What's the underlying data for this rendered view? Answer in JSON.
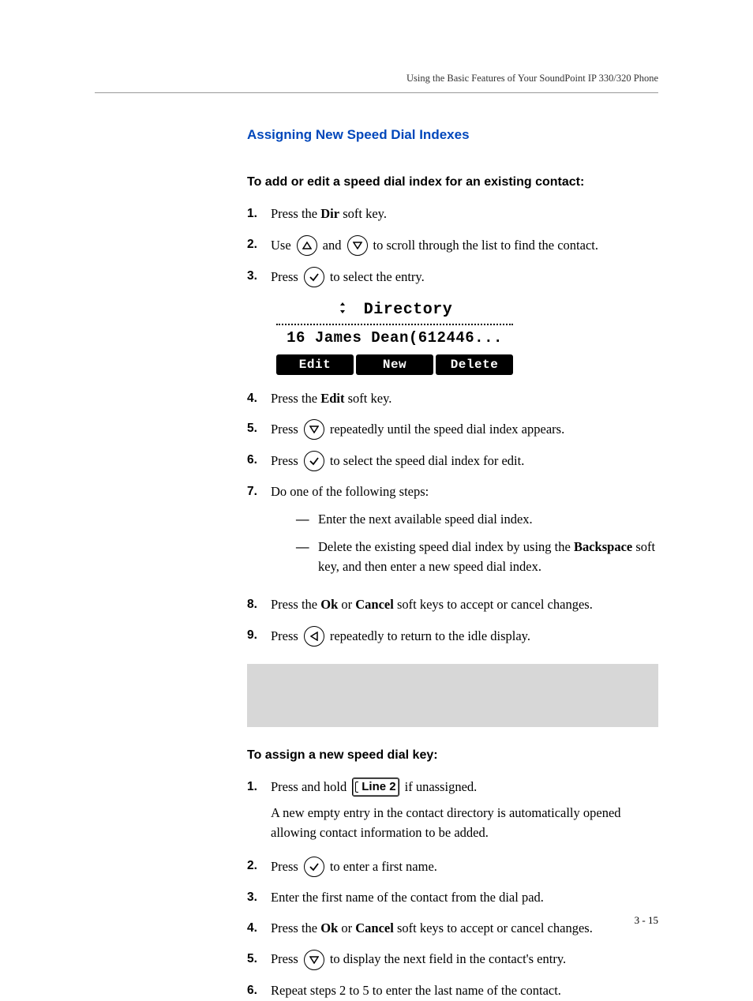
{
  "header": "Using the Basic Features of Your SoundPoint IP 330/320 Phone",
  "section_title": "Assigning New Speed Dial Indexes",
  "sub1": "To add or edit a speed dial index for an existing contact:",
  "s1": {
    "n": "1.",
    "a": "Press the ",
    "b": "Dir",
    "c": " soft key."
  },
  "s2": {
    "n": "2.",
    "a": "Use ",
    "b": " and ",
    "c": " to scroll through the list to find the contact."
  },
  "s3": {
    "n": "3.",
    "a": "Press ",
    "b": " to select the entry."
  },
  "screen": {
    "title": "Directory",
    "line2": "16 James Dean(612446...",
    "k1": "Edit",
    "k2": "New",
    "k3": "Delete"
  },
  "s4": {
    "n": "4.",
    "a": "Press the ",
    "b": "Edit",
    "c": " soft key."
  },
  "s5": {
    "n": "5.",
    "a": "Press ",
    "b": " repeatedly until the speed dial index appears."
  },
  "s6": {
    "n": "6.",
    "a": "Press ",
    "b": " to select the speed dial index for edit."
  },
  "s7": {
    "n": "7.",
    "a": "Do one of the following steps:",
    "i1": "Enter the next available speed dial index.",
    "i2a": "Delete the existing speed dial index by using the ",
    "i2b": "Backspace",
    "i2c": " soft key, and then enter a new speed dial index."
  },
  "s8": {
    "n": "8.",
    "a": "Press the ",
    "b": "Ok",
    "c": " or ",
    "d": "Cancel",
    "e": " soft keys to accept or cancel changes."
  },
  "s9": {
    "n": "9.",
    "a": "Press ",
    "b": " repeatedly to return to the idle display."
  },
  "sub2": "To assign a new speed dial key:",
  "b1": {
    "n": "1.",
    "a": "Press and hold ",
    "btn": "Line 2",
    "b": " if unassigned.",
    "para": "A new empty entry in the contact directory is automatically opened allowing contact information to be added."
  },
  "b2": {
    "n": "2.",
    "a": "Press ",
    "b": " to enter a first name."
  },
  "b3": {
    "n": "3.",
    "a": "Enter the first name of the contact from the dial pad."
  },
  "b4": {
    "n": "4.",
    "a": "Press the ",
    "b": "Ok",
    "c": " or ",
    "d": "Cancel",
    "e": " soft keys to accept or cancel changes."
  },
  "b5": {
    "n": "5.",
    "a": "Press ",
    "b": " to display the next field in the contact's entry."
  },
  "b6": {
    "n": "6.",
    "a": "Repeat steps 2 to 5 to enter the last name of the contact."
  },
  "pagenum": "3 - 15",
  "dash": "—"
}
